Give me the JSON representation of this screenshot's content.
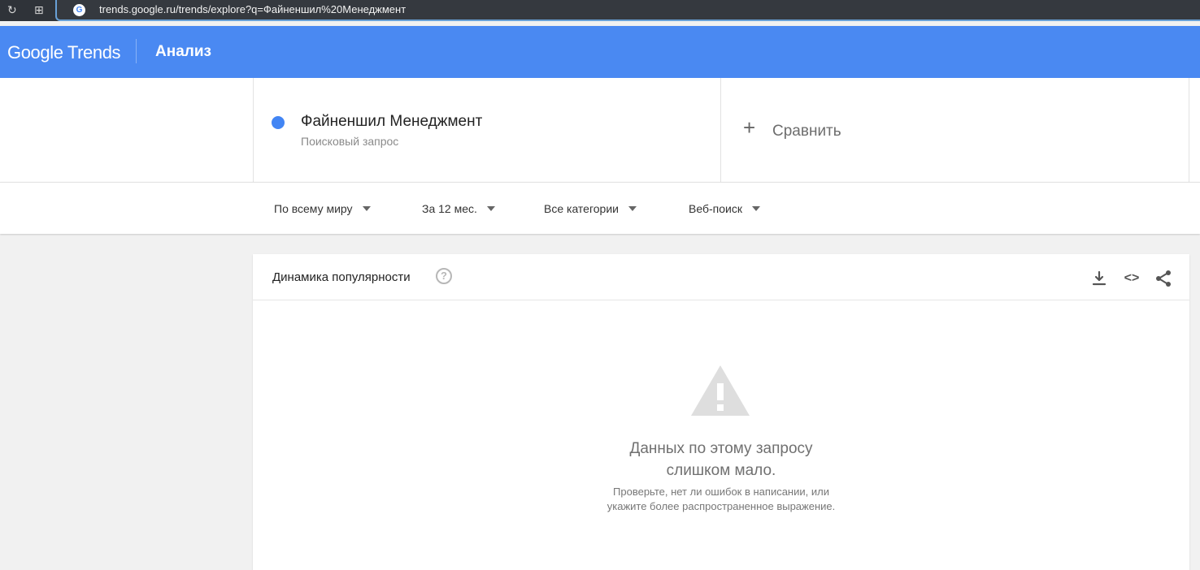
{
  "browser": {
    "url": "trends.google.ru/trends/explore?q=Файненшил%20Менеджмент",
    "favicon": "G"
  },
  "header": {
    "logo_google": "Google",
    "logo_trends": "Trends",
    "section": "Анализ"
  },
  "query": {
    "term": "Файненшил Менеджмент",
    "type": "Поисковый запрос",
    "compare": "Сравнить",
    "term_color": "#4285f4"
  },
  "filters": [
    {
      "label": "По всему миру"
    },
    {
      "label": "За 12 мес."
    },
    {
      "label": "Все категории"
    },
    {
      "label": "Веб-поиск"
    }
  ],
  "chart": {
    "title": "Динамика популярности",
    "help": "?",
    "embed": "<>",
    "message_line1": "Данных по этому запросу",
    "message_line2": "слишком мало.",
    "hint_line1": "Проверьте, нет ли ошибок в написании, или",
    "hint_line2": "укажите более распространенное выражение."
  },
  "icons": {
    "reload": "reload-icon",
    "apps": "apps-icon",
    "help": "help-icon",
    "download": "download-icon",
    "embed": "embed-icon",
    "share": "share-icon",
    "warning": "warning-icon"
  },
  "colors": {
    "header": "#4a89f2",
    "accent": "#4285f4"
  }
}
